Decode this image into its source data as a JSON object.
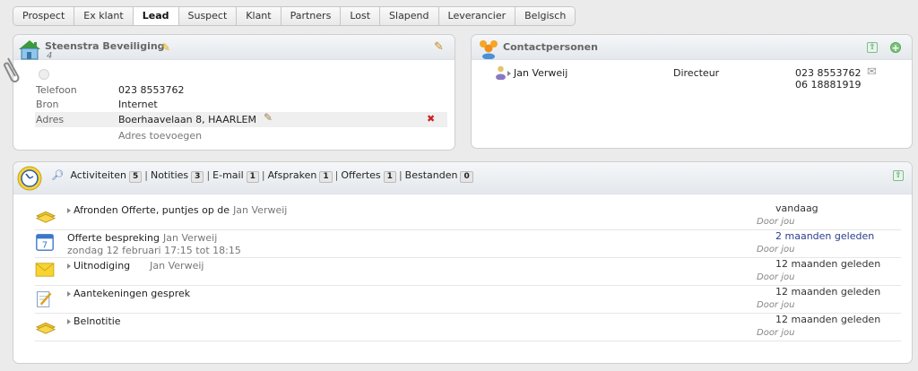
{
  "tabs": [
    "Prospect",
    "Ex klant",
    "Lead",
    "Suspect",
    "Klant",
    "Partners",
    "Lost",
    "Slapend",
    "Leverancier",
    "Belgisch"
  ],
  "active_tab": "Lead",
  "company": {
    "name": "Steenstra Beveiliging",
    "id_number": "4",
    "fields": {
      "phone_label": "Telefoon",
      "phone_value": "023 8553762",
      "source_label": "Bron",
      "source_value": "Internet",
      "address_label": "Adres",
      "address_value": "Boerhaavelaan 8, HAARLEM"
    },
    "add_address": "Adres toevoegen"
  },
  "contacts": {
    "title": "Contactpersonen",
    "items": [
      {
        "name": "Jan Verweij",
        "role": "Directeur",
        "phone": "023 8553762",
        "mobile": "06 18881919"
      }
    ]
  },
  "activity_nav": [
    {
      "label": "Activiteiten",
      "count": "5"
    },
    {
      "label": "Notities",
      "count": "3"
    },
    {
      "label": "E-mail",
      "count": "1"
    },
    {
      "label": "Afspraken",
      "count": "1"
    },
    {
      "label": "Offertes",
      "count": "1"
    },
    {
      "label": "Bestanden",
      "count": "0"
    }
  ],
  "activities": [
    {
      "icon": "note-stack-icon",
      "title": "Afronden Offerte, puntjes op de",
      "contact": "Jan Verweij",
      "subline": "",
      "time": "vandaag",
      "by": "Door jou",
      "highlight": false,
      "expandable": true
    },
    {
      "icon": "calendar-icon",
      "title": "Offerte bespreking",
      "contact": "Jan Verweij",
      "subline": "zondag 12 februari 17:15 tot 18:15",
      "time": "2 maanden geleden",
      "by": "Door jou",
      "highlight": true,
      "expandable": false
    },
    {
      "icon": "envelope-icon",
      "title": "Uitnodiging",
      "contact": "Jan Verweij",
      "subline": "",
      "time": "12 maanden geleden",
      "by": "Door jou",
      "highlight": false,
      "expandable": true
    },
    {
      "icon": "notepad-icon",
      "title": "Aantekeningen gesprek",
      "contact": "",
      "subline": "",
      "time": "12 maanden geleden",
      "by": "Door jou",
      "highlight": false,
      "expandable": true
    },
    {
      "icon": "note-stack-icon",
      "title": "Belnotitie",
      "contact": "",
      "subline": "",
      "time": "12 maanden geleden",
      "by": "Door jou",
      "highlight": false,
      "expandable": true
    }
  ]
}
